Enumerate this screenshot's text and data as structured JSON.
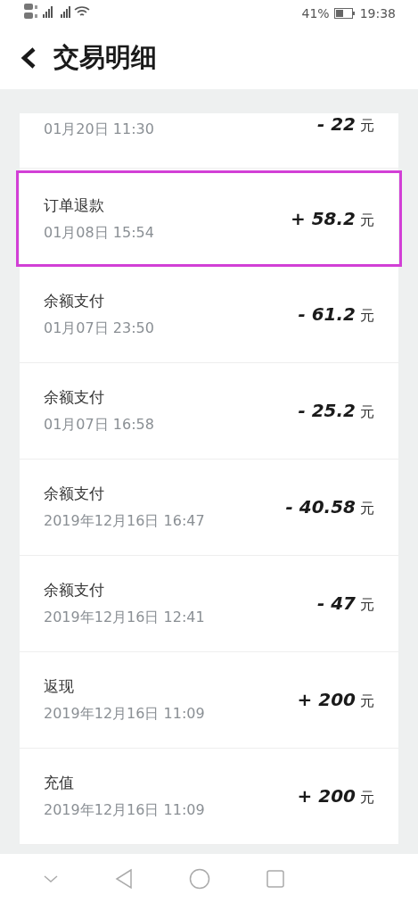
{
  "status_bar": {
    "battery_text": "41%",
    "time": "19:38"
  },
  "header": {
    "title": "交易明细"
  },
  "transactions": [
    {
      "kind": "partial",
      "date": "01月20日 11:30",
      "amount": "- 22",
      "unit": "元",
      "highlighted": false
    },
    {
      "kind": "full",
      "title": "订单退款",
      "date": "01月08日 15:54",
      "amount": "+ 58.2",
      "unit": "元",
      "highlighted": true
    },
    {
      "kind": "full",
      "title": "余额支付",
      "date": "01月07日 23:50",
      "amount": "- 61.2",
      "unit": "元",
      "highlighted": false
    },
    {
      "kind": "full",
      "title": "余额支付",
      "date": "01月07日 16:58",
      "amount": "- 25.2",
      "unit": "元",
      "highlighted": false
    },
    {
      "kind": "full",
      "title": "余额支付",
      "date": "2019年12月16日 16:47",
      "amount": "- 40.58",
      "unit": "元",
      "highlighted": false
    },
    {
      "kind": "full",
      "title": "余额支付",
      "date": "2019年12月16日 12:41",
      "amount": "- 47",
      "unit": "元",
      "highlighted": false
    },
    {
      "kind": "full",
      "title": "返现",
      "date": "2019年12月16日 11:09",
      "amount": "+ 200",
      "unit": "元",
      "highlighted": false
    },
    {
      "kind": "full",
      "title": "充值",
      "date": "2019年12月16日 11:09",
      "amount": "+ 200",
      "unit": "元",
      "highlighted": false
    }
  ]
}
